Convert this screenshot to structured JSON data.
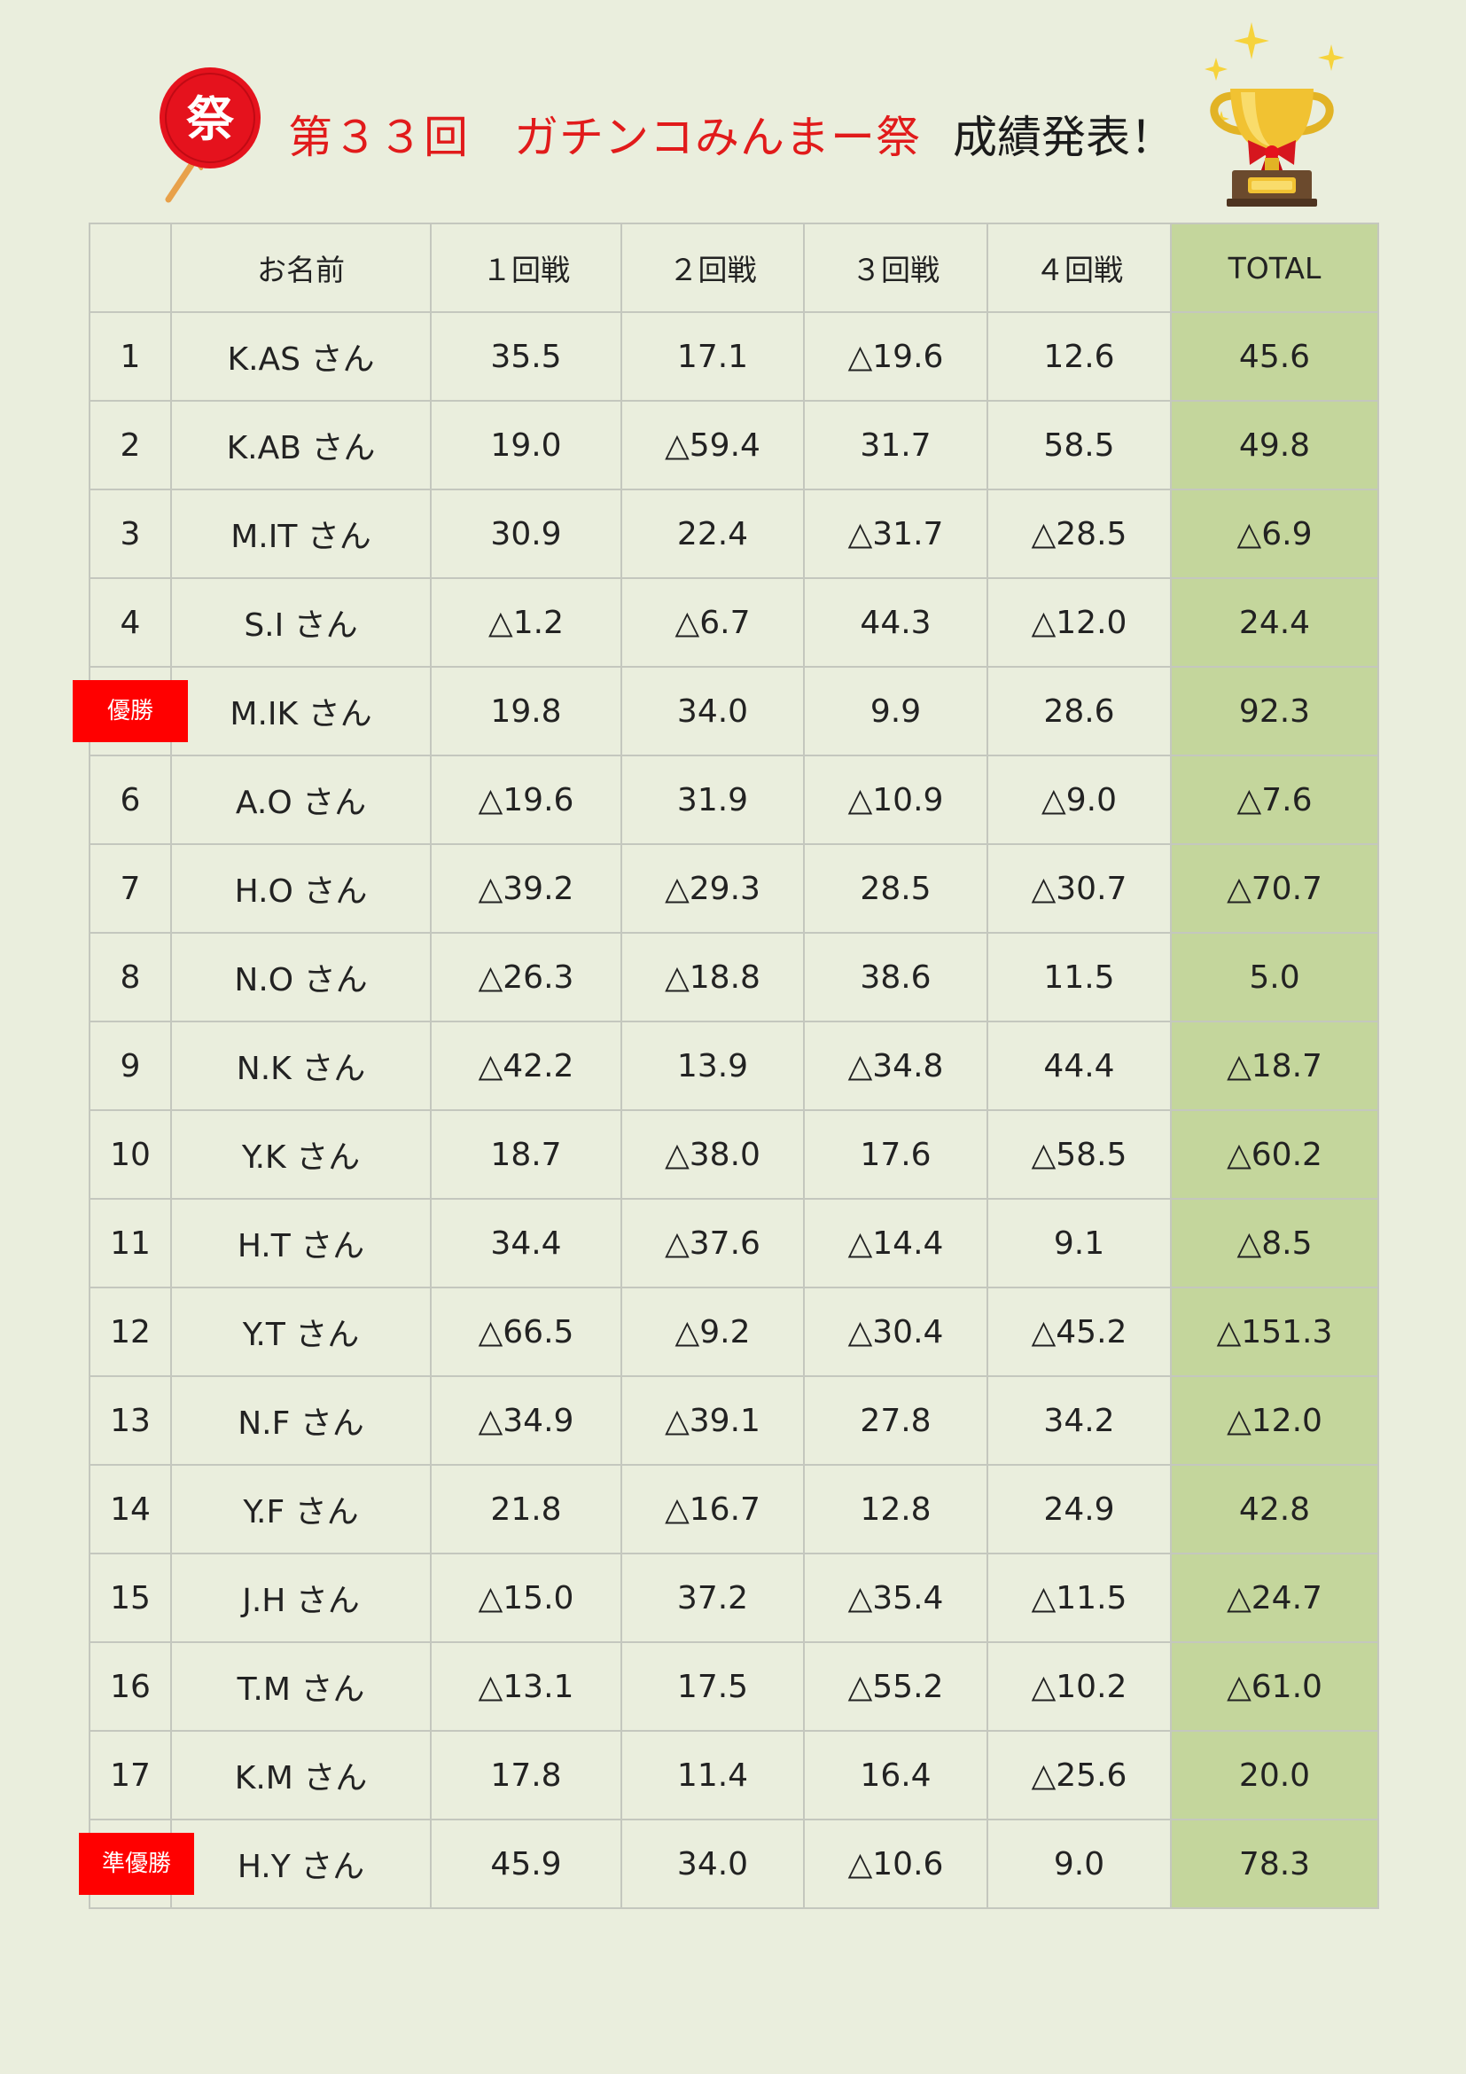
{
  "title": {
    "main": "第３３回　ガチンコみんまー祭",
    "sub": "成績発表！",
    "fan_char": "祭"
  },
  "colors": {
    "negative": "#e11b1b",
    "total_column": "#c4d69c",
    "badge": "#ff0000",
    "background": "#eaeedd"
  },
  "icons": {
    "fan": "festival-fan-icon",
    "trophy": "trophy-icon"
  },
  "table": {
    "headers": [
      "",
      "お名前",
      "１回戦",
      "２回戦",
      "３回戦",
      "４回戦",
      "TOTAL"
    ],
    "rows": [
      {
        "rank": "1",
        "name": "K.AS さん",
        "r1": "35.5",
        "r2": "17.1",
        "r3": "△19.6",
        "r4": "12.6",
        "total": "45.6"
      },
      {
        "rank": "2",
        "name": "K.AB さん",
        "r1": "19.0",
        "r2": "△59.4",
        "r3": "31.7",
        "r4": "58.5",
        "total": "49.8"
      },
      {
        "rank": "3",
        "name": "M.IT さん",
        "r1": "30.9",
        "r2": "22.4",
        "r3": "△31.7",
        "r4": "△28.5",
        "total": "△6.9"
      },
      {
        "rank": "4",
        "name": "S.I さん",
        "r1": "△1.2",
        "r2": "△6.7",
        "r3": "44.3",
        "r4": "△12.0",
        "total": "24.4"
      },
      {
        "rank": "優勝",
        "name": "M.IK さん",
        "r1": "19.8",
        "r2": "34.0",
        "r3": "9.9",
        "r4": "28.6",
        "total": "92.3"
      },
      {
        "rank": "6",
        "name": "A.O さん",
        "r1": "△19.6",
        "r2": "31.9",
        "r3": "△10.9",
        "r4": "△9.0",
        "total": "△7.6"
      },
      {
        "rank": "7",
        "name": "H.O さん",
        "r1": "△39.2",
        "r2": "△29.3",
        "r3": "28.5",
        "r4": "△30.7",
        "total": "△70.7"
      },
      {
        "rank": "8",
        "name": "N.O さん",
        "r1": "△26.3",
        "r2": "△18.8",
        "r3": "38.6",
        "r4": "11.5",
        "total": "5.0"
      },
      {
        "rank": "9",
        "name": "N.K さん",
        "r1": "△42.2",
        "r2": "13.9",
        "r3": "△34.8",
        "r4": "44.4",
        "total": "△18.7"
      },
      {
        "rank": "10",
        "name": "Y.K さん",
        "r1": "18.7",
        "r2": "△38.0",
        "r3": "17.6",
        "r4": "△58.5",
        "total": "△60.2"
      },
      {
        "rank": "11",
        "name": "H.T さん",
        "r1": "34.4",
        "r2": "△37.6",
        "r3": "△14.4",
        "r4": "9.1",
        "total": "△8.5"
      },
      {
        "rank": "12",
        "name": "Y.T さん",
        "r1": "△66.5",
        "r2": "△9.2",
        "r3": "△30.4",
        "r4": "△45.2",
        "total": "△151.3"
      },
      {
        "rank": "13",
        "name": "N.F さん",
        "r1": "△34.9",
        "r2": "△39.1",
        "r3": "27.8",
        "r4": "34.2",
        "total": "△12.0"
      },
      {
        "rank": "14",
        "name": "Y.F さん",
        "r1": "21.8",
        "r2": "△16.7",
        "r3": "12.8",
        "r4": "24.9",
        "total": "42.8"
      },
      {
        "rank": "15",
        "name": "J.H さん",
        "r1": "△15.0",
        "r2": "37.2",
        "r3": "△35.4",
        "r4": "△11.5",
        "total": "△24.7"
      },
      {
        "rank": "16",
        "name": "T.M さん",
        "r1": "△13.1",
        "r2": "17.5",
        "r3": "△55.2",
        "r4": "△10.2",
        "total": "△61.0"
      },
      {
        "rank": "17",
        "name": "K.M さん",
        "r1": "17.8",
        "r2": "11.4",
        "r3": "16.4",
        "r4": "△25.6",
        "total": "20.0"
      },
      {
        "rank": "準優勝",
        "name": "H.Y さん",
        "r1": "45.9",
        "r2": "34.0",
        "r3": "△10.6",
        "r4": "9.0",
        "total": "78.3"
      }
    ]
  }
}
